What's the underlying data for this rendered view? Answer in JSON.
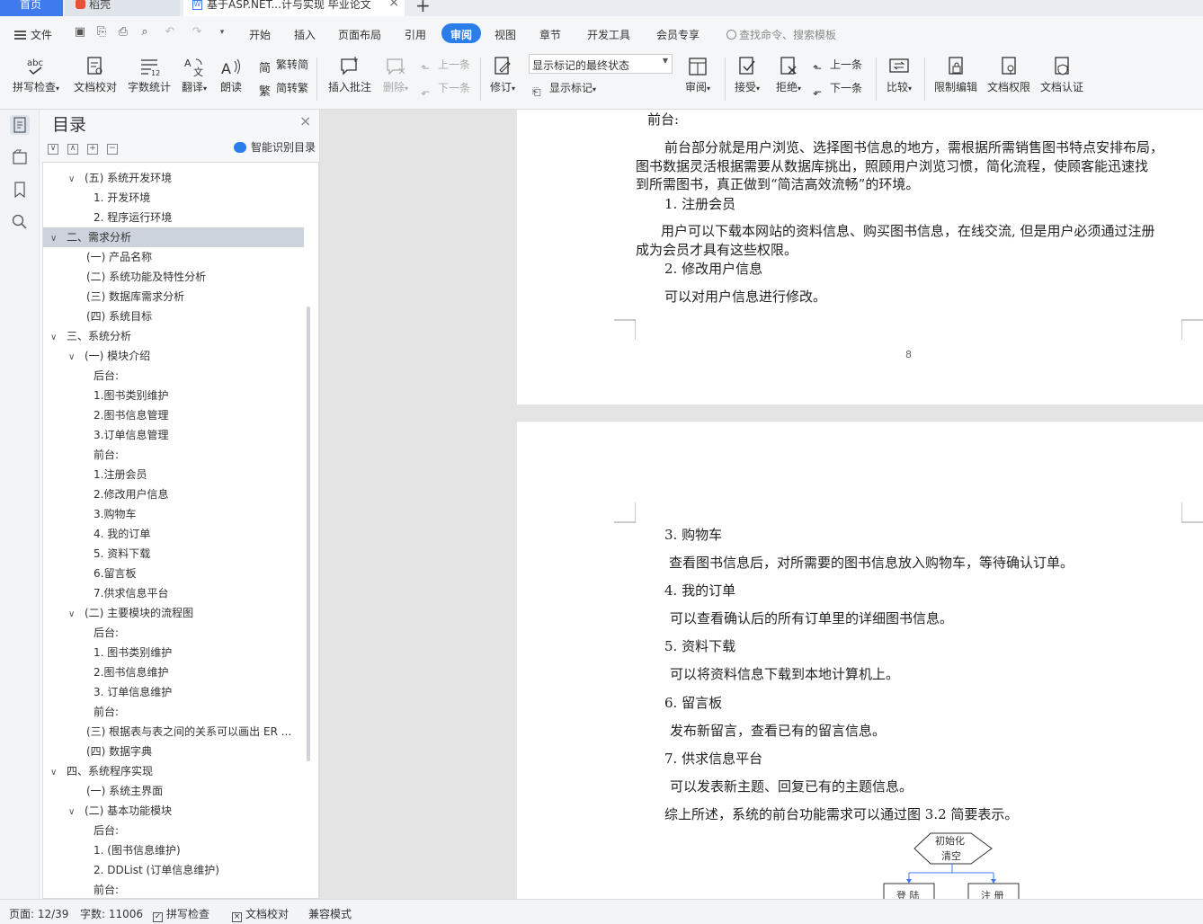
{
  "tabs": {
    "home": "首页",
    "doke": "稻壳",
    "doc": "基于ASP.NET...计与实现 毕业论文"
  },
  "menu": {
    "file": "文件",
    "items": [
      "开始",
      "插入",
      "页面布局",
      "引用",
      "审阅",
      "视图",
      "章节",
      "开发工具",
      "会员专享"
    ],
    "search_placeholder": "查找命令、搜索模板"
  },
  "ribbon": {
    "spell": "拼写检查",
    "proof": "文档校对",
    "count": "字数统计",
    "translate": "翻译",
    "read": "朗读",
    "trad": "繁转简",
    "simp": "简转繁",
    "insert_comment": "插入批注",
    "delete": "删除",
    "prev_comment": "上一条",
    "next_comment": "下一条",
    "revise": "修订",
    "markup_state": "显示标记的最终状态",
    "show_markup": "显示标记",
    "review": "审阅",
    "accept": "接受",
    "reject": "拒绝",
    "prev_change": "上一条",
    "next_change": "下一条",
    "compare": "比较",
    "restrict": "限制编辑",
    "permission": "文档权限",
    "certify": "文档认证"
  },
  "toc": {
    "title": "目录",
    "smart": "智能识别目录",
    "items": [
      {
        "text": "(五)  系统开发环境",
        "chev": "v"
      },
      {
        "text": "1. 开发环境",
        "chev": ""
      },
      {
        "text": "2. 程序运行环境",
        "chev": ""
      },
      {
        "text": "二、需求分析",
        "chev": "v"
      },
      {
        "text": "(一)  产品名称",
        "chev": ""
      },
      {
        "text": "(二)  系统功能及特性分析",
        "chev": ""
      },
      {
        "text": "(三)  数据库需求分析",
        "chev": ""
      },
      {
        "text": "(四)  系统目标",
        "chev": ""
      },
      {
        "text": "三、系统分析",
        "chev": "v"
      },
      {
        "text": "(一) 模块介绍",
        "chev": "v"
      },
      {
        "text": "后台:",
        "chev": ""
      },
      {
        "text": "1.图书类别维护",
        "chev": ""
      },
      {
        "text": "2.图书信息管理",
        "chev": ""
      },
      {
        "text": "3.订单信息管理",
        "chev": ""
      },
      {
        "text": "前台:",
        "chev": ""
      },
      {
        "text": "1.注册会员",
        "chev": ""
      },
      {
        "text": "2.修改用户信息",
        "chev": ""
      },
      {
        "text": "3.购物车",
        "chev": ""
      },
      {
        "text": "4. 我的订单",
        "chev": ""
      },
      {
        "text": "5. 资料下载",
        "chev": ""
      },
      {
        "text": "6.留言板",
        "chev": ""
      },
      {
        "text": "7.供求信息平台",
        "chev": ""
      },
      {
        "text": "(二) 主要模块的流程图",
        "chev": "v"
      },
      {
        "text": "后台:",
        "chev": ""
      },
      {
        "text": "1. 图书类别维护",
        "chev": ""
      },
      {
        "text": "2.图书信息维护",
        "chev": ""
      },
      {
        "text": "3. 订单信息维护",
        "chev": ""
      },
      {
        "text": "前台:",
        "chev": ""
      },
      {
        "text": "(三) 根据表与表之间的关系可以画出 ER ...",
        "chev": ""
      },
      {
        "text": "(四) 数据字典",
        "chev": ""
      },
      {
        "text": "四、系统程序实现",
        "chev": "v"
      },
      {
        "text": "(一) 系统主界面",
        "chev": ""
      },
      {
        "text": "(二) 基本功能模块",
        "chev": "v"
      },
      {
        "text": "后台:",
        "chev": ""
      },
      {
        "text": "1. (图书信息维护)",
        "chev": ""
      },
      {
        "text": "2. DDList (订单信息维护)",
        "chev": ""
      },
      {
        "text": "前台:",
        "chev": ""
      }
    ]
  },
  "page1": {
    "lines": [
      "前台:",
      "前台部分就是用户浏览、选择图书信息的地方，需根据所需销售图书特点安排布局，",
      "图书数据灵活根据需要从数据库挑出，照顾用户浏览习惯，简化流程，使顾客能迅速找",
      "到所需图书，真正做到“简洁高效流畅”的环境。",
      "1.  注册会员",
      "用户可以下载本网站的资料信息、购买图书信息，在线交流, 但是用户必须通过注册",
      "成为会员才具有这些权限。",
      "2.  修改用户信息",
      "可以对用户信息进行修改。"
    ],
    "page_number": "8"
  },
  "page2": {
    "lines": [
      "3.  购物车",
      "查看图书信息后，对所需要的图书信息放入购物车，等待确认订单。",
      "4.  我的订单",
      "可以查看确认后的所有订单里的详细图书信息。",
      "5.  资料下载",
      "可以将资料信息下载到本地计算机上。",
      "6.  留言板",
      "发布新留言，查看已有的留言信息。",
      "7.  供求信息平台",
      "可以发表新主题、回复已有的主题信息。",
      "综上所述，系统的前台功能需求可以通过图 3.2 简要表示。"
    ],
    "flow": {
      "init1": "初始化",
      "init2": "清空",
      "login": "登 陆",
      "register": "注 册"
    }
  },
  "status": {
    "page": "页面: 12/39",
    "words": "字数: 11006",
    "spell": "拼写检查",
    "proof": "文档校对",
    "compat": "兼容模式"
  }
}
